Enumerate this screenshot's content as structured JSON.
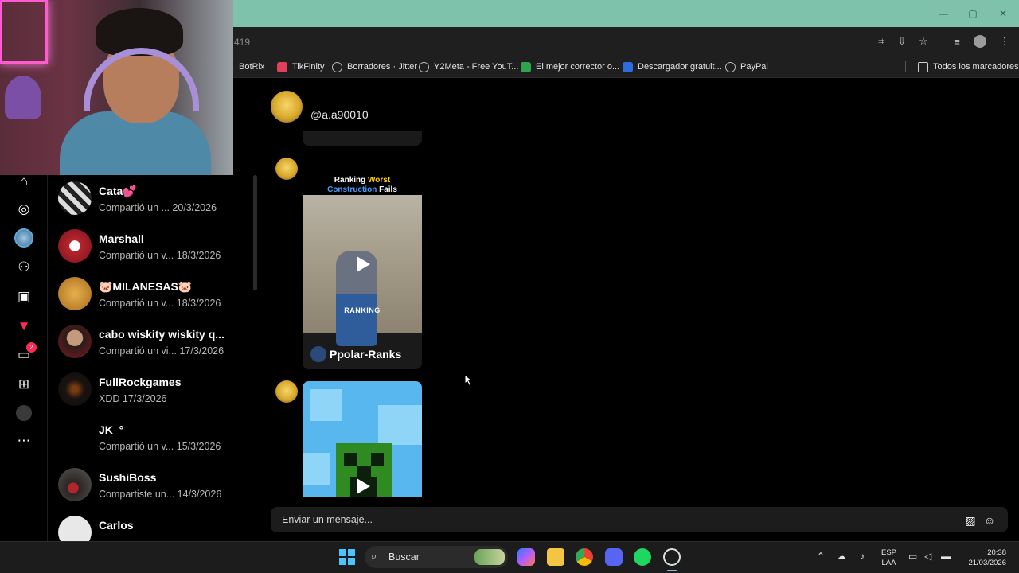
{
  "browser": {
    "address_fragment": "419",
    "window_controls": {
      "minimize": "—",
      "maximize": "▢",
      "close": "✕"
    },
    "bookmarks": [
      {
        "label": "BotRix",
        "icon": "botrix-icon",
        "color": "#6c6c6c"
      },
      {
        "label": "TikFinity",
        "icon": "tikfinity-icon",
        "color": "#e0405a"
      },
      {
        "label": "Borradores · Jitter",
        "icon": "globe-icon",
        "color": "#777777"
      },
      {
        "label": "Y2Meta - Free YouT...",
        "icon": "globe-icon",
        "color": "#777777"
      },
      {
        "label": "El mejor corrector o...",
        "icon": "corrector-icon",
        "color": "#2da44e"
      },
      {
        "label": "Descargador gratuit...",
        "icon": "infinity-icon",
        "color": "#2d6cdf"
      },
      {
        "label": "PayPal",
        "icon": "globe-icon",
        "color": "#777777"
      }
    ],
    "all_bookmarks": "Todos los marcadores"
  },
  "sidebar": {
    "messages_badge": "2"
  },
  "conversations": [
    {
      "name": "Cata💕",
      "preview": "Compartió un ...",
      "date": "20/3/2026"
    },
    {
      "name": "Marshall",
      "preview": "Compartió un v...",
      "date": "18/3/2026"
    },
    {
      "name": "🐷MILANESAS🐷",
      "preview": "Compartió un v...",
      "date": "18/3/2026"
    },
    {
      "name": "cabo wiskity wiskity q...",
      "preview": "Compartió un vi...",
      "date": "17/3/2026"
    },
    {
      "name": "FullRockgames",
      "preview": "XDD",
      "date": "17/3/2026"
    },
    {
      "name": "JK_°",
      "preview": "Compartió un v...",
      "date": "15/3/2026"
    },
    {
      "name": "SushiBoss",
      "preview": "Compartiste un...",
      "date": "14/3/2026"
    },
    {
      "name": "Carlos",
      "preview": "",
      "date": ""
    }
  ],
  "chat": {
    "handle": "@a.a90010",
    "video1": {
      "title_part1": "Ranking ",
      "title_highlight1": "Worst",
      "title_part2": "Construction",
      "title_highlight2": " Fails",
      "overlay_label": "RANKING",
      "author": "Ppolar-Ranks"
    },
    "input_placeholder": "Enviar un mensaje..."
  },
  "taskbar": {
    "search_label": "Buscar",
    "language": "ESP",
    "region": "LAA",
    "time": "20:38",
    "date": "21/03/2026"
  }
}
